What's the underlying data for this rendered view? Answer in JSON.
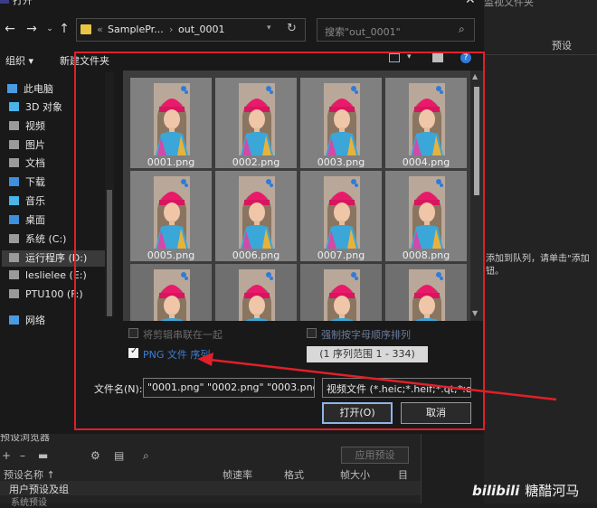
{
  "dialog": {
    "title": "打开",
    "address": {
      "crumb1": "SamplePr...",
      "crumb2": "out_0001"
    },
    "search_placeholder": "搜索\"out_0001\"",
    "organize": "组织 ▾",
    "new_folder": "新建文件夹",
    "sidebar": [
      {
        "label": "此电脑",
        "icon": "computer-icon",
        "color": "#4a9be0"
      },
      {
        "label": "3D 对象",
        "icon": "cube-icon",
        "color": "#4ab3e8"
      },
      {
        "label": "视频",
        "icon": "video-icon",
        "color": "#9a9a9a"
      },
      {
        "label": "图片",
        "icon": "image-icon",
        "color": "#9a9a9a"
      },
      {
        "label": "文档",
        "icon": "document-icon",
        "color": "#9a9a9a"
      },
      {
        "label": "下载",
        "icon": "download-icon",
        "color": "#3d8fe0"
      },
      {
        "label": "音乐",
        "icon": "music-icon",
        "color": "#4ab3e8"
      },
      {
        "label": "桌面",
        "icon": "desktop-icon",
        "color": "#3d8fe0"
      },
      {
        "label": "系统 (C:)",
        "icon": "drive-icon",
        "color": "#9a9a9a"
      },
      {
        "label": "运行程序 (D:)",
        "icon": "drive-icon",
        "color": "#9a9a9a"
      },
      {
        "label": "leslielee (E:)",
        "icon": "drive-icon",
        "color": "#9a9a9a"
      },
      {
        "label": "PTU100 (F:)",
        "icon": "drive-icon",
        "color": "#9a9a9a"
      },
      {
        "label": "网络",
        "icon": "network-icon",
        "color": "#4a9be0"
      }
    ],
    "files": [
      "0001.png",
      "0002.png",
      "0003.png",
      "0004.png",
      "0005.png",
      "0006.png",
      "0007.png",
      "0008.png",
      "",
      "",
      "",
      ""
    ],
    "options": {
      "join_label": "将剪辑串联在一起",
      "join_checked": false,
      "png_sequence_label": "PNG 文件 序列",
      "png_sequence_checked": true,
      "alpha_order_label": "强制按字母顺序排列",
      "alpha_order_checked": false,
      "range": "(1 序列范围 1 - 334)"
    },
    "filename_label": "文件名(N):",
    "filename_value": "\"0001.png\" \"0002.png\" \"0003.png\"",
    "filetype_value": "视频文件 (*.heic;*.heif;*.qt;*.ep",
    "open_button": "打开(O)",
    "cancel_button": "取消"
  },
  "background": {
    "right_title": "监视文件夹",
    "right_preset": "预设",
    "right_message": "添加到队列，请单击\"添加\n钮。",
    "bottom_title": "预设浏览器",
    "bottom_apply": "应用预设",
    "columns": [
      "预设名称 ↑",
      "帧速率",
      "格式",
      "帧大小",
      "目"
    ],
    "row1": "用户预设及组",
    "row2": "系统预设"
  },
  "watermark": {
    "brand": "bilibili",
    "text": "糖醋河马"
  }
}
